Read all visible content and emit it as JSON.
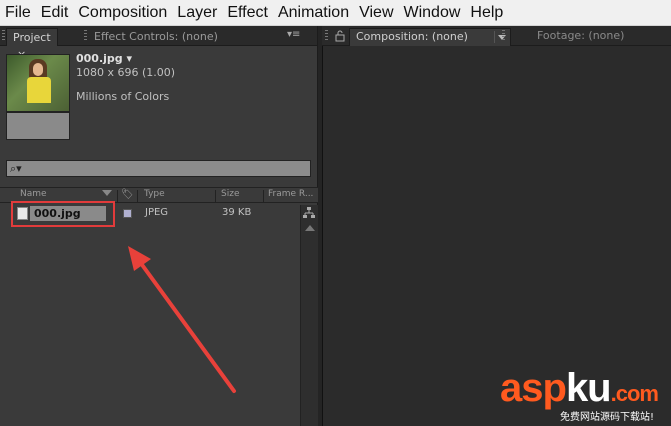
{
  "menu": [
    "File",
    "Edit",
    "Composition",
    "Layer",
    "Effect",
    "Animation",
    "View",
    "Window",
    "Help"
  ],
  "project_panel": {
    "tab_project": "Project",
    "tab_close": "×",
    "tab_effect_controls": "Effect Controls: (none)",
    "menu_glyph": "▾≡",
    "file_title": "000.jpg ▾",
    "dimensions": "1080 x 696 (1.00)",
    "color_depth": "Millions of Colors",
    "search_placeholder": "",
    "columns": {
      "name": "Name",
      "type": "Type",
      "size": "Size",
      "frame_rate": "Frame R..."
    },
    "items": [
      {
        "name": "000.jpg",
        "type": "JPEG",
        "size": "39 KB"
      }
    ]
  },
  "comp_panel": {
    "comp_tab": "Composition: (none)",
    "footage_tab": "Footage: (none)"
  },
  "watermark": {
    "logo_asp": "asp",
    "logo_ku": "ku",
    "logo_tld": ".com",
    "subtitle": "免费网站源码下载站!"
  },
  "colors": {
    "highlight": "#e23b3b",
    "arrow": "#e8413a",
    "watermark_orange": "#ff5a1f"
  }
}
